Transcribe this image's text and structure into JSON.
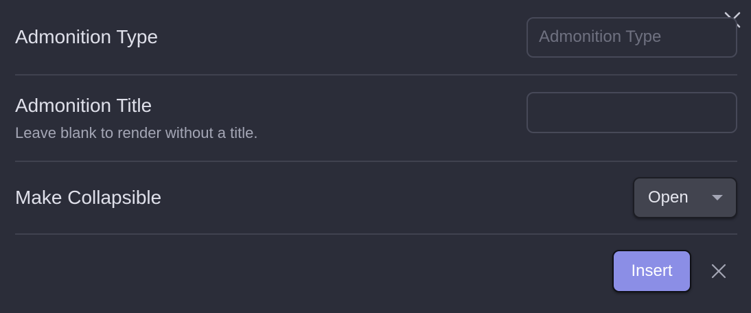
{
  "modal": {
    "close_icon": "close-icon",
    "colors": {
      "background": "#2b2d39",
      "accent": "#8b8ee6",
      "divider": "#40424f"
    }
  },
  "settings": {
    "type": {
      "name": "Admonition Type",
      "input_value": "",
      "input_placeholder": "Admonition Type"
    },
    "title": {
      "name": "Admonition Title",
      "description": "Leave blank to render without a title.",
      "input_value": "",
      "input_placeholder": ""
    },
    "collapsible": {
      "name": "Make Collapsible",
      "selected": "Open",
      "dropdown_icon": "caret-down-icon"
    }
  },
  "footer": {
    "insert_label": "Insert",
    "cancel_icon": "close-icon"
  }
}
